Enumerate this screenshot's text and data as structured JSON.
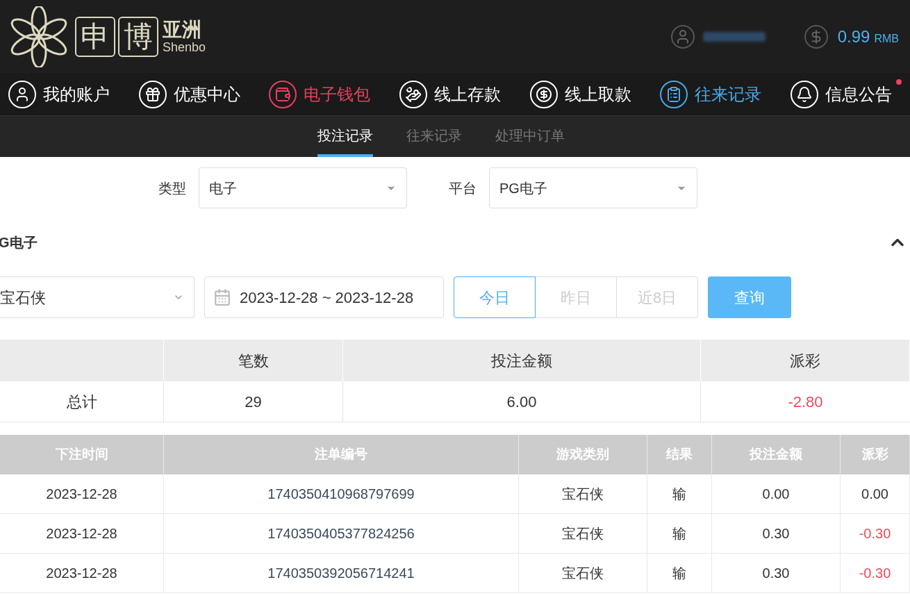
{
  "header": {
    "logo": {
      "boxed": [
        "申",
        "博"
      ],
      "region": "亚洲",
      "latin": "Shenbo"
    },
    "balance": {
      "amount": "0.99",
      "currency": "RMB"
    }
  },
  "nav": [
    {
      "label": "我的账户",
      "color": "#ffffff",
      "badge": false
    },
    {
      "label": "优惠中心",
      "color": "#ffffff",
      "badge": false
    },
    {
      "label": "电子钱包",
      "color": "#e5415e",
      "badge": false
    },
    {
      "label": "线上存款",
      "color": "#ffffff",
      "badge": false
    },
    {
      "label": "线上取款",
      "color": "#ffffff",
      "badge": false
    },
    {
      "label": "往来记录",
      "color": "#4aa8e8",
      "badge": false
    },
    {
      "label": "信息公告",
      "color": "#ffffff",
      "badge": true
    }
  ],
  "subtabs": [
    {
      "label": "投注记录",
      "selected": true
    },
    {
      "label": "往来记录",
      "selected": false
    },
    {
      "label": "处理中订单",
      "selected": false
    }
  ],
  "filters": [
    {
      "label": "类型",
      "value": "电子"
    },
    {
      "label": "平台",
      "value": "PG电子"
    }
  ],
  "section": {
    "title": "G电子",
    "expanded": true
  },
  "query": {
    "game": "宝石侠",
    "date_range": "2023-12-28 ~ 2023-12-28",
    "days": [
      {
        "label": "今日",
        "selected": true
      },
      {
        "label": "昨日",
        "selected": false
      },
      {
        "label": "近8日",
        "selected": false
      }
    ],
    "button": "查询"
  },
  "summary": {
    "columns": [
      "笔数",
      "投注金额",
      "派彩"
    ],
    "row": {
      "label": "总计",
      "count": "29",
      "amount": "6.00",
      "payout": "-2.80",
      "negative": true
    }
  },
  "table": {
    "columns": [
      "下注时间",
      "注单编号",
      "游戏类别",
      "结果",
      "投注金额",
      "派彩"
    ],
    "rows": [
      {
        "cells": [
          "2023-12-28",
          "1740350410968797699",
          "宝石侠",
          "输",
          "0.00",
          "0.00"
        ],
        "negative": false
      },
      {
        "cells": [
          "2023-12-28",
          "1740350405377824256",
          "宝石侠",
          "输",
          "0.30",
          "-0.30"
        ],
        "negative": true
      },
      {
        "cells": [
          "2023-12-28",
          "1740350392056714241",
          "宝石侠",
          "输",
          "0.30",
          "-0.30"
        ],
        "negative": true
      }
    ]
  }
}
